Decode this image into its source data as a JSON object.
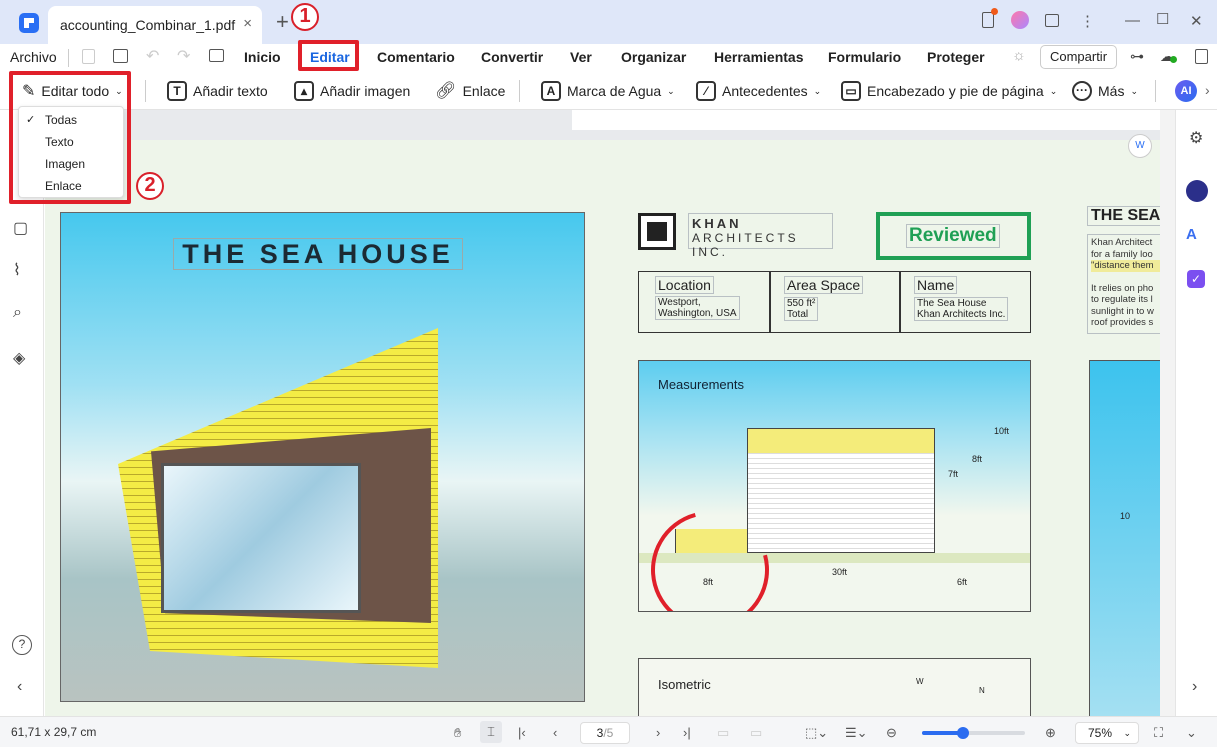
{
  "tab": {
    "title": "accounting_Combinar_1.pdf",
    "close": "×",
    "new_tab": "+"
  },
  "annotations": {
    "step1": "1",
    "step2": "2"
  },
  "window": {
    "minimize": "—",
    "maximize": "☐",
    "close": "✕",
    "more": "⋮"
  },
  "menu": {
    "archivo": "Archivo",
    "items": [
      "Inicio",
      "Editar",
      "Comentario",
      "Convertir",
      "Ver",
      "Organizar",
      "Herramientas",
      "Formulario",
      "Proteger"
    ],
    "active": "Editar",
    "share": "Compartir"
  },
  "toolbar": {
    "edit_all": "Editar todo",
    "add_text": "Añadir texto",
    "add_image": "Añadir imagen",
    "link": "Enlace",
    "watermark": "Marca de Agua",
    "background": "Antecedentes",
    "header_footer": "Encabezado y pie de página",
    "more": "Más",
    "ai": "AI"
  },
  "dropdown": {
    "items": [
      "Todas",
      "Texto",
      "Imagen",
      "Enlace"
    ],
    "selected": "Todas"
  },
  "document": {
    "title": "THE SEA HOUSE",
    "logo_line1": "KHAN",
    "logo_line2": "ARCHITECTS INC.",
    "stamp": "Reviewed",
    "info": [
      {
        "label": "Location",
        "value1": "Westport,",
        "value2": "Washington, USA"
      },
      {
        "label": "Area Space",
        "value1": "550 ft²",
        "value2": "Total"
      },
      {
        "label": "Name",
        "value1": "The Sea House",
        "value2": "Khan Architects Inc."
      }
    ],
    "right_title": "THE SEA",
    "right_text": [
      "Khan Architect",
      "for a family loo",
      "\"distance them",
      "",
      "It relies on pho",
      "to regulate its l",
      "sunlight in to w",
      "roof provides s"
    ],
    "measurements": {
      "title": "Measurements",
      "labels": [
        "10ft",
        "8ft",
        "7ft",
        "8ft",
        "30ft",
        "6ft"
      ]
    },
    "isometric": {
      "title": "Isometric",
      "w": "W",
      "n": "N"
    },
    "right_dim": "10"
  },
  "status": {
    "dimensions": "61,71 x 29,7 cm",
    "page_current": "3",
    "page_total": "/5",
    "zoom": "75%",
    "zoom_fraction": 0.4
  },
  "colors": {
    "accent": "#1a66e0",
    "annotation_red": "#e0202a",
    "stamp_green": "#1fa055"
  }
}
